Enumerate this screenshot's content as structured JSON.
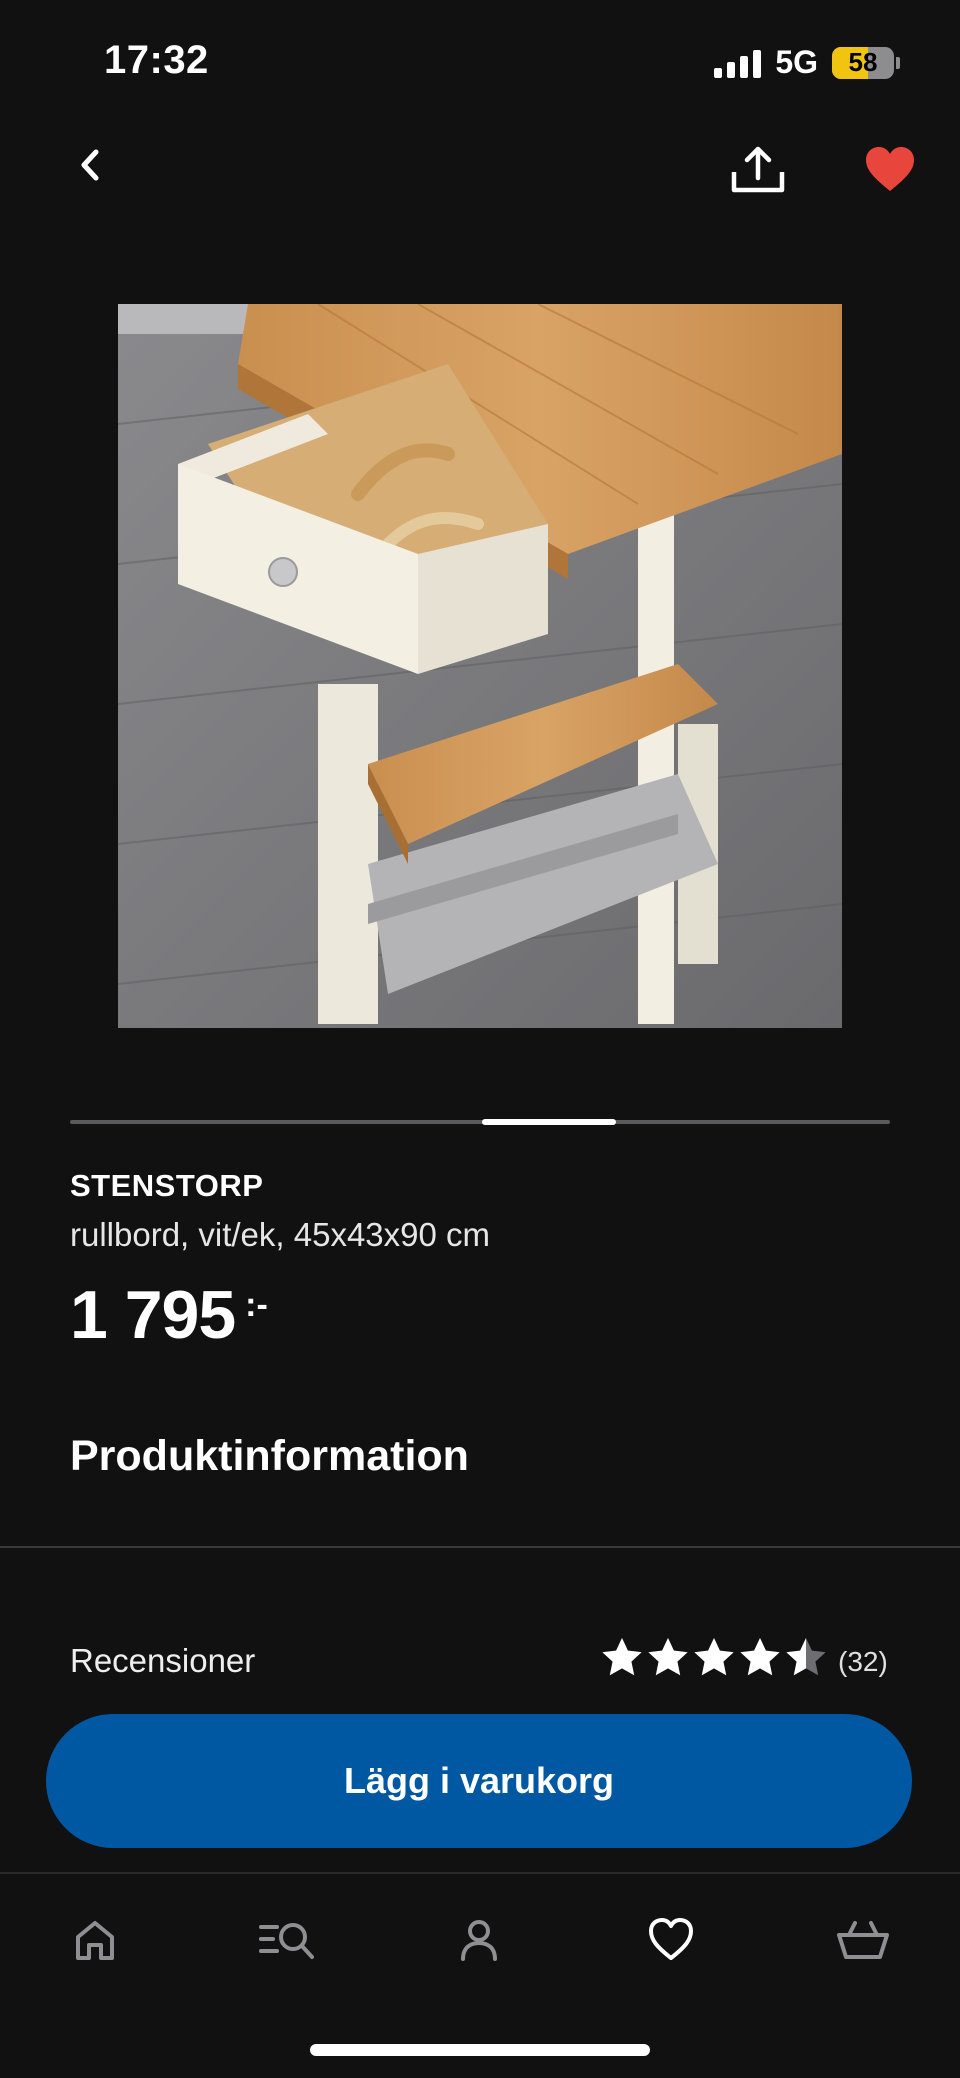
{
  "status_bar": {
    "time": "17:32",
    "network": "5G",
    "battery": "58",
    "battery_level": 0.58,
    "battery_color": "#f1c40f"
  },
  "nav": {
    "back_icon": "chevron-left-icon",
    "share_icon": "share-icon",
    "favorite_icon": "heart-filled-icon",
    "favorite_color": "#e8453c"
  },
  "product": {
    "name": "STENSTORP",
    "description": "rullbord, vit/ek, 45x43x90 cm",
    "price": "1 795",
    "price_suffix": ":-",
    "image_count_position": {
      "current": 3,
      "total": 5
    }
  },
  "sections": {
    "product_info_title": "Produktinformation"
  },
  "reviews": {
    "label": "Recensioner",
    "rating": 4.5,
    "max_rating": 5,
    "count": "(32)"
  },
  "actions": {
    "add_to_cart_label": "Lägg i varukorg",
    "accent_color": "#0058a3"
  },
  "tab_bar": {
    "items": [
      {
        "icon": "home-icon"
      },
      {
        "icon": "search-list-icon"
      },
      {
        "icon": "profile-icon"
      },
      {
        "icon": "heart-outline-icon",
        "active": true
      },
      {
        "icon": "basket-icon"
      }
    ]
  }
}
